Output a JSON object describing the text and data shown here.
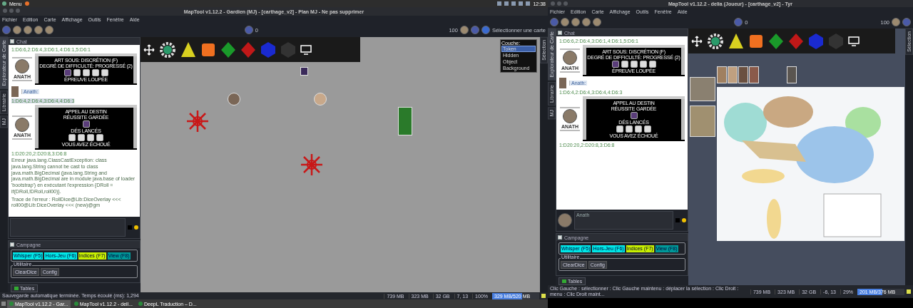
{
  "desktop_panel": {
    "menu": "Menu",
    "clock": "12:38"
  },
  "windows": [
    {
      "title": "MapTool v1.12.2 - Gardien (MJ) - [carthage_v2] - Plan MJ - Ne pas supprimer",
      "menu": [
        "Fichier",
        "Edition",
        "Carte",
        "Affichage",
        "Outils",
        "Fenêtre",
        "Aide"
      ],
      "toolbar": {
        "vision_value": "0",
        "zoom_value": "100",
        "map_select": "Sélectionner une carte"
      },
      "side_tabs": [
        {
          "label": "Explorateur de Carte",
          "selected": true
        },
        {
          "label": "Librairie",
          "selected": false
        },
        {
          "label": "MJ",
          "selected": false
        }
      ],
      "right_tab": "Sélection",
      "chat": {
        "title": "Chat",
        "messages": [
          {
            "kind": "roll",
            "text": "1:D6:6,2:D6:4,3:D6:1,4:D6:1,5:D6:1",
            "highlighted": false
          },
          {
            "kind": "card",
            "avatar_name": "ANATH",
            "rows": [
              {
                "kind": "text",
                "text": "ART SOUS: DISCRÉTION (F)"
              },
              {
                "kind": "text",
                "text": "DEGRÉ DE DIFFICULTÉ: PROGRESSÉ (2)"
              },
              {
                "kind": "slots",
                "token": true
              },
              {
                "kind": "text",
                "text": "ÉPREUVE LOUPÉE"
              }
            ]
          },
          {
            "kind": "speaker",
            "name": "Anath:"
          },
          {
            "kind": "roll",
            "text": "1:D6:4,2:D6:4,3:D6:4,4:D6:3",
            "highlighted": true
          },
          {
            "kind": "card",
            "avatar_name": "ANATH",
            "rows": [
              {
                "kind": "text",
                "text": "APPEL AU DESTIN"
              },
              {
                "kind": "text",
                "text": "RÉUSSITE GARDÉE"
              },
              {
                "kind": "token"
              },
              {
                "kind": "text",
                "text": "DÉS LANCÉS"
              },
              {
                "kind": "slots",
                "token": false
              },
              {
                "kind": "text",
                "text": "VOUS AVEZ ÉCHOUÉ"
              }
            ]
          },
          {
            "kind": "roll",
            "text": "1:D20:20,2:D20:8,3:D6:8",
            "highlighted": false
          },
          {
            "kind": "error",
            "text": "Erreur java.lang.ClassCastException: class java.lang.String cannot be cast to class java.math.BigDecimal (java.lang.String and java.math.BigDecimal are in module java.base of loader 'bootstrap') en exécutant l'expression {DRoll = if(DRoll,!DRoll,roll00)}."
          },
          {
            "kind": "error",
            "text": "Trace de l'erreur : RollDice@Lib:DiceOverlay <<< roll00@Lib:DiceOverlay <<< (new)@gm"
          }
        ]
      },
      "map": {
        "kind": "gm_canvas",
        "layers": {
          "title": "Couche:",
          "items": [
            {
              "label": "Token",
              "selected": true
            },
            {
              "label": "Hidden",
              "selected": false
            },
            {
              "label": "Object",
              "selected": false
            },
            {
              "label": "Background",
              "selected": false
            }
          ]
        }
      },
      "campaign": {
        "title": "Campagne",
        "macros": [
          {
            "label": "Whisper",
            "key": "(F5)",
            "color": "#00e8e8"
          },
          {
            "label": "Hors-Jeu",
            "key": "(F6)",
            "color": "#00e8e8"
          },
          {
            "label": "Indices",
            "key": "(F7)",
            "color": "#c8f000"
          },
          {
            "label": "View",
            "key": "(F8)",
            "color": "#009a9a"
          }
        ],
        "group": "Utilitaire",
        "utility": [
          "ClearDice",
          "Config"
        ]
      },
      "tables_tab": "Tables",
      "status": {
        "message": "Sauvegarde automatique terminée. Temps écoulé (ms): 1,294",
        "cells": [
          "739 MB",
          "323 MB",
          "32 GB",
          "7, 13",
          "100%"
        ],
        "memory": {
          "text": "329 MB/520 MB",
          "level": 0.63
        }
      }
    },
    {
      "title": "MapTool v1.12.2 - delia (Joueur) - [carthage_v2] - Tyr",
      "menu": [
        "Fichier",
        "Edition",
        "Carte",
        "Affichage",
        "Outils",
        "Fenêtre",
        "Aide"
      ],
      "toolbar": {
        "vision_value": "0",
        "zoom_value": "100"
      },
      "side_tabs": [
        {
          "label": "Explorateur de Carte",
          "selected": true
        },
        {
          "label": "Librairie",
          "selected": false
        },
        {
          "label": "MJ",
          "selected": false
        }
      ],
      "right_tab": "Sélection",
      "chat": {
        "title": "Chat",
        "input_name": "Anath",
        "messages": [
          {
            "kind": "roll",
            "text": "1:D6:6,2:D6:4,3:D6:1,4:D6:1,5:D6:1",
            "highlighted": false
          },
          {
            "kind": "card",
            "avatar_name": "ANATH",
            "rows": [
              {
                "kind": "text",
                "text": "ART SOUS: DISCRÉTION (F)"
              },
              {
                "kind": "text",
                "text": "DEGRÉ DE DIFFICULTÉ: PROGRESSÉ (2)"
              },
              {
                "kind": "slots",
                "token": true
              },
              {
                "kind": "text",
                "text": "ÉPREUVE LOUPÉE"
              }
            ]
          },
          {
            "kind": "speaker",
            "name": "Anath:"
          },
          {
            "kind": "roll",
            "text": "1:D6:4,2:D6:4,3:D6:4,4:D6:3",
            "highlighted": false
          },
          {
            "kind": "card",
            "avatar_name": "ANATH",
            "rows": [
              {
                "kind": "text",
                "text": "APPEL AU DESTIN"
              },
              {
                "kind": "text",
                "text": "RÉUSSITE GARDÉE"
              },
              {
                "kind": "token"
              },
              {
                "kind": "text",
                "text": "DÉS LANCÉS"
              },
              {
                "kind": "slots",
                "token": false
              },
              {
                "kind": "text",
                "text": "VOUS AVEZ ÉCHOUÉ"
              }
            ]
          },
          {
            "kind": "roll",
            "text": "1:D20:20,2:D20:8,3:D6:8",
            "highlighted": false
          }
        ]
      },
      "map": {
        "kind": "player_map"
      },
      "campaign": {
        "title": "Campagne",
        "macros": [
          {
            "label": "Whisper",
            "key": "(F5)",
            "color": "#00e8e8"
          },
          {
            "label": "Hors-Jeu",
            "key": "(F6)",
            "color": "#00e8e8"
          },
          {
            "label": "Indices",
            "key": "(F7)",
            "color": "#c8f000"
          },
          {
            "label": "View",
            "key": "(F8)",
            "color": "#009a9a"
          }
        ],
        "group": "Utilitaire",
        "utility": [
          "ClearDice",
          "Config"
        ]
      },
      "tables_tab": "Tables",
      "status": {
        "message": "Clic Gauche : sélectionner : Clic Gauche maintenu : déplacer la sélection : Clic Droit : menu : Clic Droit maint...",
        "cells": [
          "739 MB",
          "323 MB",
          "32 GB",
          "-6, 13",
          "29%"
        ],
        "memory": {
          "text": "201 MB/376 MB",
          "level": 0.53
        }
      }
    }
  ],
  "taskbar": [
    {
      "label": "MapTool v1.12.2 - Gar...",
      "selected": true
    },
    {
      "label": "MapTool v1.12.2 - dell...",
      "selected": false
    },
    {
      "label": "DeepL Traduction – D...",
      "selected": false
    }
  ]
}
